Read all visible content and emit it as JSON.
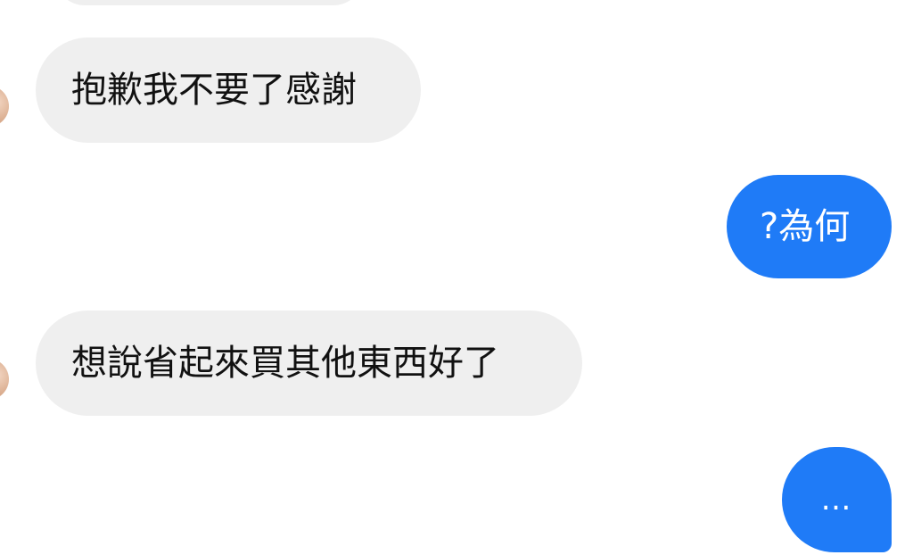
{
  "messages": [
    {
      "direction": "incoming",
      "text": "抱歉我不要了感謝"
    },
    {
      "direction": "outgoing",
      "text": "?為何"
    },
    {
      "direction": "incoming",
      "text": "想說省起來買其他東西好了"
    },
    {
      "direction": "outgoing",
      "text": "…"
    }
  ],
  "colors": {
    "incoming_bubble": "#efefef",
    "outgoing_bubble": "#1f7bf7",
    "incoming_text": "#111111",
    "outgoing_text": "#ffffff"
  }
}
